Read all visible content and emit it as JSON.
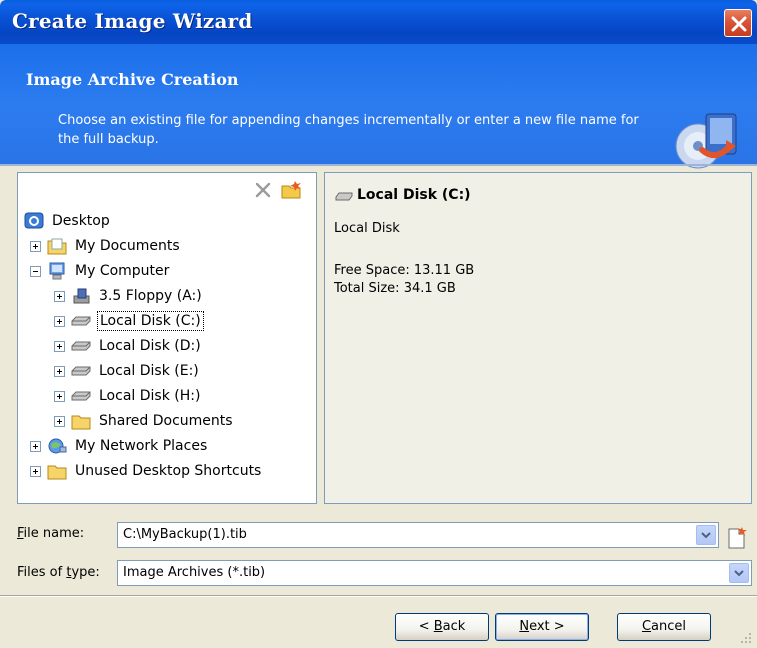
{
  "window": {
    "title": "Create Image Wizard"
  },
  "header": {
    "title": "Image Archive Creation",
    "description": "Choose an existing file for appending changes incrementally or enter a new file name for the full backup."
  },
  "tree": {
    "items": [
      {
        "label": "Desktop",
        "icon": "desktop-icon"
      },
      {
        "label": "My Documents",
        "icon": "my-documents-folder-icon"
      },
      {
        "label": "My Computer",
        "icon": "my-computer-icon"
      },
      {
        "label": "3.5 Floppy (A:)",
        "icon": "floppy-drive-icon"
      },
      {
        "label": "Local Disk (C:)",
        "icon": "hard-disk-icon",
        "selected": true
      },
      {
        "label": "Local Disk (D:)",
        "icon": "hard-disk-icon"
      },
      {
        "label": "Local Disk (E:)",
        "icon": "hard-disk-icon"
      },
      {
        "label": "Local Disk (H:)",
        "icon": "hard-disk-icon"
      },
      {
        "label": "Shared Documents",
        "icon": "folder-icon"
      },
      {
        "label": "My Network Places",
        "icon": "network-places-icon"
      },
      {
        "label": "Unused Desktop Shortcuts",
        "icon": "folder-icon"
      }
    ]
  },
  "details": {
    "title": "Local Disk (C:)",
    "type": "Local Disk",
    "free_space": "Free Space: 13.11 GB",
    "total_size": "Total Size: 34.1 GB"
  },
  "form": {
    "file_name_label_prefix": "",
    "file_name_label_key": "F",
    "file_name_label_rest": "ile name:",
    "file_name_value": "C:\\MyBackup(1).tib",
    "files_of_type_label_prefix": "Files of ",
    "files_of_type_label_key": "t",
    "files_of_type_label_rest": "ype:",
    "files_of_type_value": "Image Archives (*.tib)"
  },
  "buttons": {
    "back_prefix": "< ",
    "back_key": "B",
    "back_rest": "ack",
    "next_key": "N",
    "next_rest": "ext >",
    "cancel_key": "C",
    "cancel_rest": "ancel"
  },
  "colors": {
    "titlebar": "#0A53D6",
    "header": "#2C7CF0",
    "dialog_bg": "#ECE9D8",
    "close_button": "#D8553A"
  }
}
